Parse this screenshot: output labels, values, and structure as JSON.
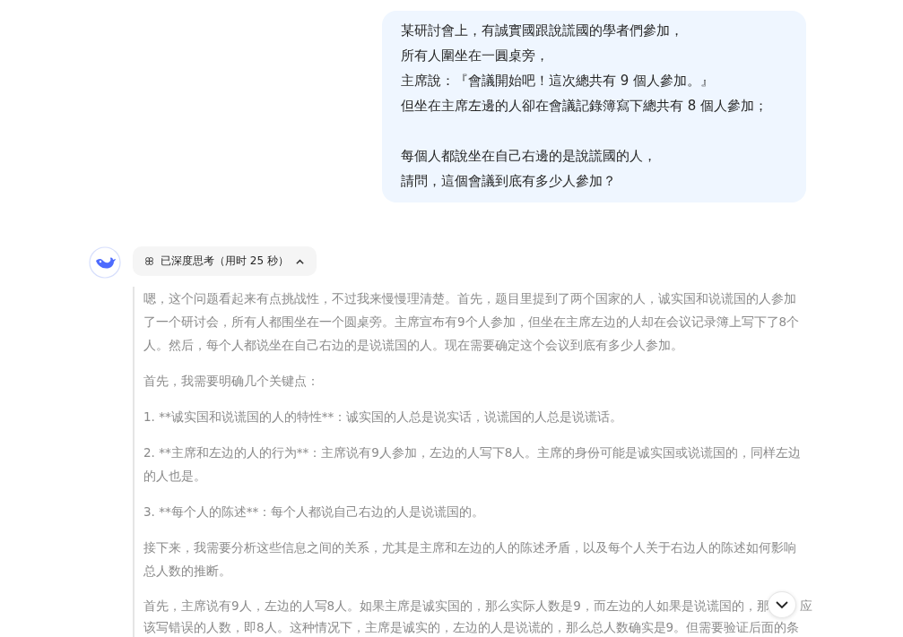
{
  "user_message": {
    "paragraphs": [
      [
        "某研討會上，有誠實國跟說謊國的學者們參加，",
        "所有人圍坐在一圓桌旁，",
        "主席說：『會議開始吧！這次總共有 9 個人參加。』",
        "但坐在主席左邊的人卻在會議記錄簿寫下總共有 8 個人參加；"
      ],
      [
        "每個人都說坐在自己右邊的是說謊國的人，",
        "請問，這個會議到底有多少人參加？"
      ]
    ]
  },
  "thinking_toggle": {
    "label": "已深度思考（用时 25 秒）",
    "expanded": true
  },
  "reasoning": [
    {
      "kind": "text",
      "lines": [
        "嗯，这个问题看起来有点挑战性，不过我来慢慢理清楚。首先，题目里提到了两个国家的人，诚实国和说谎国的人参加",
        "了一个研讨会，所有人都围坐在一个圆桌旁。主席宣布有9个人参加，但坐在主席左边的人却在会议记录簿上写下了8个",
        "人。然后，每个人都说坐在自己右边的是说谎国的人。现在需要确定这个会议到底有多少人参加。"
      ]
    },
    {
      "kind": "text",
      "lines": [
        "首先，我需要明确几个关键点："
      ]
    },
    {
      "kind": "text",
      "lines": [
        "1. **诚实国和说谎国的人的特性**：诚实国的人总是说实话，说谎国的人总是说谎话。"
      ]
    },
    {
      "kind": "text",
      "lines": [
        "2. **主席和左边的人的行为**：主席说有9人参加，左边的人写下8人。主席的身份可能是诚实国或说谎国的，同样左边",
        "的人也是。"
      ]
    },
    {
      "kind": "text",
      "lines": [
        "3. **每个人的陈述**：每个人都说自己右边的人是说谎国的。"
      ]
    },
    {
      "kind": "text",
      "lines": [
        "接下来，我需要分析这些信息之间的关系，尤其是主席和左边的人的陈述矛盾，以及每个人关于右边人的陈述如何影响",
        "总人数的推断。"
      ]
    },
    {
      "kind": "covered",
      "before": "首先，主席说有9人，左边的人写8人。如果主席是诚实国的，那么实际人数是9，而左边的人如果是说谎国的，那",
      "after": "应",
      "next": "该写错误的人数，即8人。这种情况下，主席是诚实的，左边的人是说谎的，那么总人数确实是9。但需要验证后面的条"
    }
  ]
}
